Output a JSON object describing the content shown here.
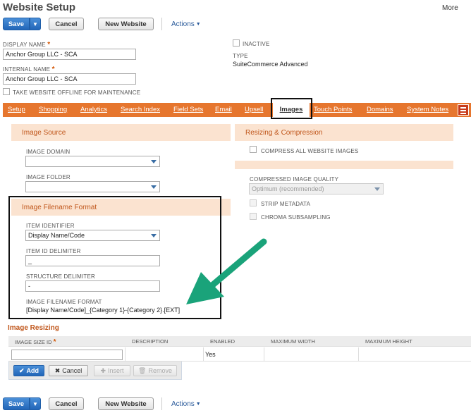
{
  "page": {
    "title": "Website Setup",
    "more_label": "More"
  },
  "toolbar": {
    "save_label": "Save",
    "cancel_label": "Cancel",
    "new_website_label": "New Website",
    "actions_label": "Actions"
  },
  "fields": {
    "display_name": {
      "label": "DISPLAY NAME",
      "value": "Anchor Group LLC - SCA"
    },
    "internal_name": {
      "label": "INTERNAL NAME",
      "value": "Anchor Group LLC - SCA"
    },
    "offline": {
      "label": "TAKE WEBSITE OFFLINE FOR MAINTENANCE"
    },
    "inactive": {
      "label": "INACTIVE"
    },
    "type": {
      "label": "TYPE",
      "value": "SuiteCommerce Advanced"
    }
  },
  "tabs": [
    {
      "label": "Setup"
    },
    {
      "label": "Shopping"
    },
    {
      "label": "Analytics"
    },
    {
      "label": "Search Index"
    },
    {
      "label": "Field Sets"
    },
    {
      "label": "Email"
    },
    {
      "label": "Upsell"
    },
    {
      "label": "Images"
    },
    {
      "label": "Touch Points"
    },
    {
      "label": "Domains"
    },
    {
      "label": "System Notes"
    }
  ],
  "image_source": {
    "title": "Image Source",
    "domain_label": "IMAGE DOMAIN",
    "folder_label": "IMAGE FOLDER"
  },
  "resizing": {
    "title": "Resizing & Compression",
    "compress_label": "COMPRESS ALL WEBSITE IMAGES",
    "quality_label": "COMPRESSED IMAGE QUALITY",
    "quality_value": "Optimum (recommended)",
    "strip_label": "STRIP METADATA",
    "chroma_label": "CHROMA SUBSAMPLING"
  },
  "filename_format": {
    "title": "Image Filename Format",
    "identifier_label": "ITEM IDENTIFIER",
    "identifier_value": "Display Name/Code",
    "id_delim_label": "ITEM ID DELIMITER",
    "id_delim_value": "_",
    "struct_delim_label": "STRUCTURE DELIMITER",
    "struct_delim_value": "-",
    "format_label": "IMAGE FILENAME FORMAT",
    "format_value": "[Display Name/Code]_{Category 1}-{Category 2}.[EXT]"
  },
  "image_resizing": {
    "title": "Image Resizing",
    "columns": [
      "IMAGE SIZE ID",
      "DESCRIPTION",
      "ENABLED",
      "MAXIMUM WIDTH",
      "MAXIMUM HEIGHT"
    ],
    "row": {
      "enabled": "Yes"
    },
    "add_label": "Add",
    "cancel_label": "Cancel",
    "insert_label": "Insert",
    "remove_label": "Remove"
  },
  "colors": {
    "tab_bar": "#e6762e",
    "section_bg": "#fbe3d0",
    "primary": "#2266b8",
    "arrow": "#1aa37a"
  }
}
